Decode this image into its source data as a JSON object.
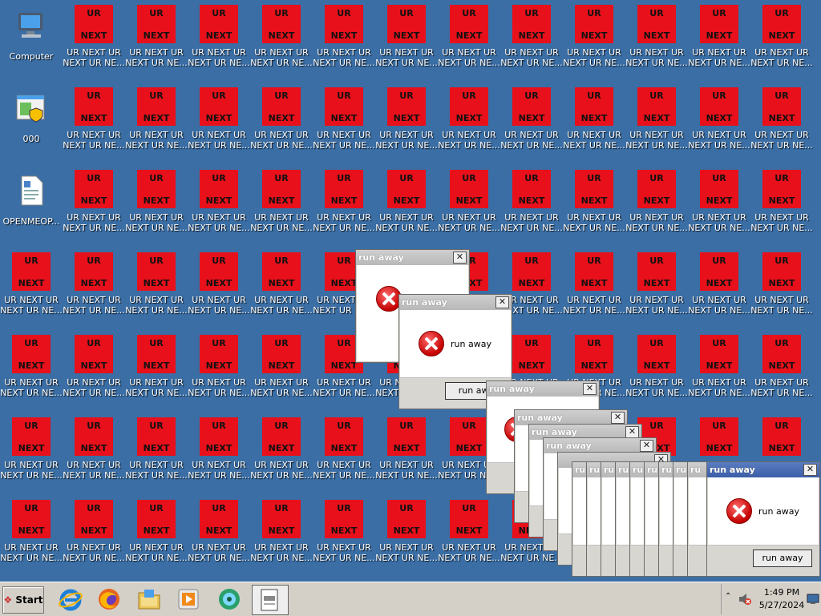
{
  "desktop": {
    "system_icons": [
      {
        "label": "Computer"
      },
      {
        "label": "000"
      },
      {
        "label": "OPENMEOP..."
      }
    ],
    "virus_icon": {
      "top_text": "UR",
      "bottom_text": "NEXT",
      "label": "UR NEXT UR NEXT UR NE..."
    }
  },
  "dialog": {
    "title": "run away",
    "message": "run away",
    "button": "run away",
    "stack_button_partial": "run awa",
    "title_partial": "ru"
  },
  "taskbar": {
    "start_label": "Start",
    "apps": [
      "internet-explorer-icon",
      "firefox-icon",
      "explorer-folder-icon",
      "media-player-icon",
      "messenger-icon",
      "document-icon"
    ],
    "clock_time": "1:49 PM",
    "clock_date": "5/27/2024"
  }
}
